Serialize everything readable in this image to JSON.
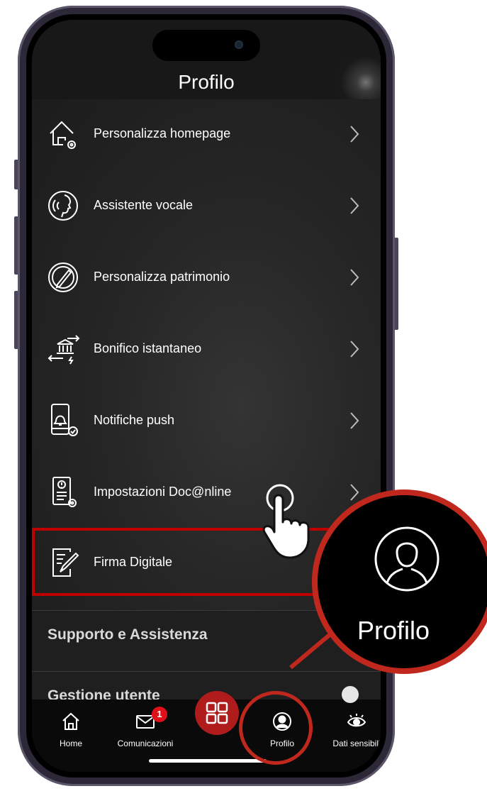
{
  "header": {
    "title": "Profilo"
  },
  "menu": [
    {
      "label": "Personalizza homepage",
      "icon": "home-settings-icon"
    },
    {
      "label": "Assistente vocale",
      "icon": "voice-assistant-icon"
    },
    {
      "label": "Personalizza patrimonio",
      "icon": "pie-chart-pencil-icon"
    },
    {
      "label": "Bonifico istantaneo",
      "icon": "instant-transfer-icon"
    },
    {
      "label": "Notifiche push",
      "icon": "phone-bell-icon"
    },
    {
      "label": "Impostazioni Doc@nline",
      "icon": "document-settings-icon"
    },
    {
      "label": "Firma Digitale",
      "icon": "digital-signature-icon"
    }
  ],
  "sections": [
    {
      "label": "Supporto e Assistenza"
    },
    {
      "label": "Gestione utente"
    }
  ],
  "tabbar": {
    "items": [
      {
        "label": "Home",
        "icon": "home-icon"
      },
      {
        "label": "Comunicazioni",
        "icon": "mail-icon",
        "badge": "1"
      },
      {
        "label": "",
        "icon": "grid-apps-icon"
      },
      {
        "label": "Profilo",
        "icon": "profile-icon"
      },
      {
        "label": "Dati sensibili",
        "icon": "eye-icon"
      }
    ]
  },
  "callout": {
    "label": "Profilo"
  },
  "colors": {
    "accent": "#c0281e",
    "background": "#181818",
    "text": "#ffffff"
  }
}
